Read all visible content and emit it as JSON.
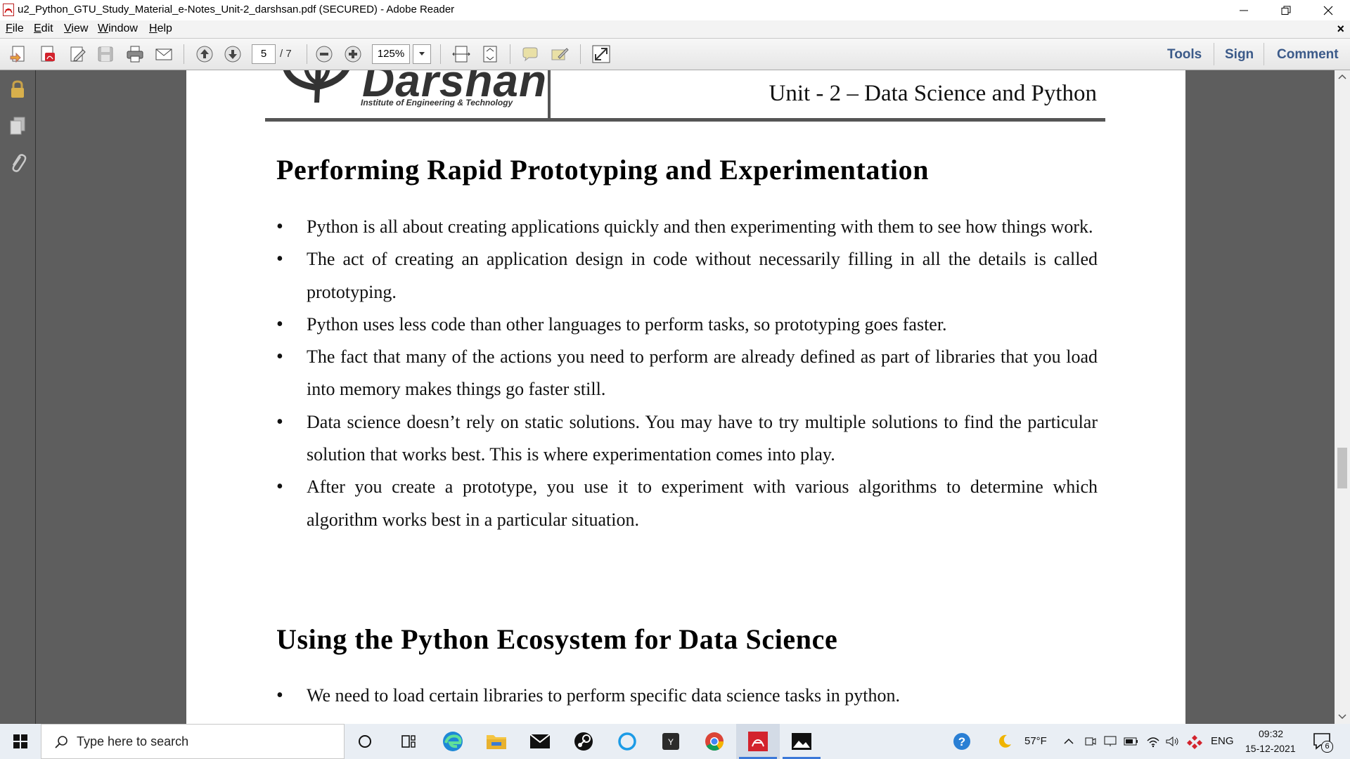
{
  "window": {
    "title": "u2_Python_GTU_Study_Material_e-Notes_Unit-2_darshsan.pdf (SECURED) - Adobe Reader"
  },
  "menu": {
    "file": "File",
    "edit": "Edit",
    "view": "View",
    "window": "Window",
    "help": "Help",
    "close_doc": "×"
  },
  "toolbar": {
    "page_current": "5",
    "page_total": "/ 7",
    "zoom": "125%",
    "tools": "Tools",
    "sign": "Sign",
    "comment": "Comment"
  },
  "document": {
    "logo_name": "Darshan",
    "logo_subtitle": "Institute of Engineering & Technology",
    "unit_title": "Unit - 2 – Data Science and Python",
    "section1_heading": "Performing Rapid Prototyping and Experimentation",
    "section1_bullets": [
      "Python is all about creating applications quickly and then experimenting with them to see how things work.",
      "The act of creating an application design in code without necessarily filling in all the details is called prototyping.",
      "Python uses less code than other languages to perform tasks, so prototyping goes faster.",
      "The fact that many of the actions you need to perform are already defined as part of libraries that you load into memory makes things go faster still.",
      "Data science doesn’t rely on static solutions. You may have to try multiple solutions to find the particular solution that works best. This is where experimentation comes into play.",
      "After you create a prototype, you use it to experiment with various algorithms to determine which algorithm works best in a particular situation."
    ],
    "section2_heading": "Using the Python Ecosystem for Data Science",
    "section2_bullets": [
      "We need to load certain libraries to perform specific data science tasks in python."
    ]
  },
  "taskbar": {
    "search_placeholder": "Type here to search",
    "apps": [
      "task-view",
      "edge",
      "file-explorer",
      "mail",
      "steam",
      "cortana",
      "yahoo",
      "chrome",
      "adobe-reader",
      "photos"
    ],
    "temperature": "57°F",
    "language": "ENG",
    "time": "09:32",
    "date": "15-12-2021",
    "notification_count": "6"
  },
  "colors": {
    "link_blue": "#3b5a89",
    "reader_red": "#d3232d",
    "taskbar_bg": "#e9eef4",
    "viewer_bg": "#5e5e5e"
  }
}
